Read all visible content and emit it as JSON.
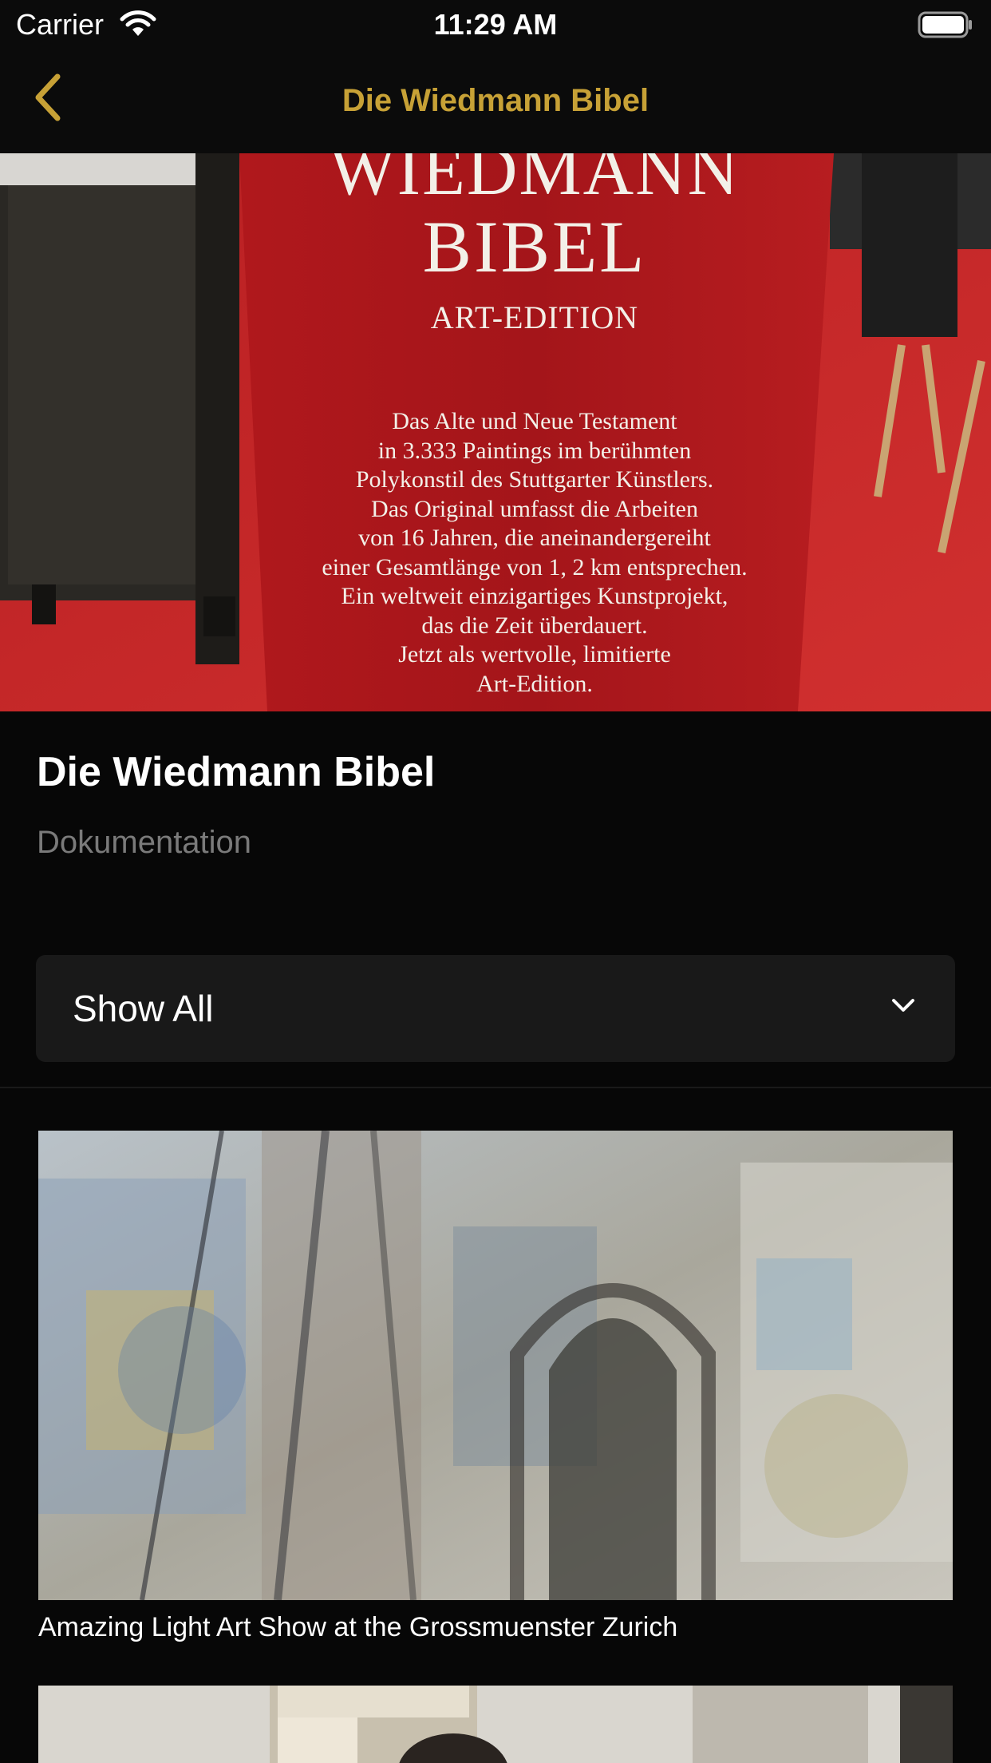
{
  "status_bar": {
    "carrier": "Carrier",
    "time": "11:29 AM"
  },
  "nav": {
    "title": "Die Wiedmann Bibel"
  },
  "hero": {
    "banner_line1": "WIEDMANN",
    "banner_line2": "BIBEL",
    "banner_subtitle": "ART-EDITION",
    "banner_description": "Das Alte und Neue Testament\nin 3.333 Paintings im berühmten\nPolykonstil des Stuttgarter Künstlers.\nDas Original umfasst die Arbeiten\nvon 16 Jahren, die aneinandergereiht\neiner Gesamtlänge von 1, 2 km entsprechen.\nEin weltweit einzigartiges Kunstprojekt,\ndas die Zeit überdauert.\nJetzt als wertvolle, limitierte\nArt-Edition."
  },
  "show": {
    "title": "Die Wiedmann Bibel",
    "category": "Dokumentation"
  },
  "filter": {
    "selected": "Show All"
  },
  "videos": [
    {
      "title": "Amazing Light Art Show at the Grossmuenster Zurich"
    },
    {
      "title": ""
    }
  ],
  "colors": {
    "accent": "#c7a136",
    "background": "#070707",
    "card": "#191919",
    "secondary_text": "#7a7a7a"
  },
  "icons": {
    "back": "chevron-left-icon",
    "filter": "chevron-down-icon",
    "wifi": "wifi-icon",
    "battery": "battery-icon"
  }
}
